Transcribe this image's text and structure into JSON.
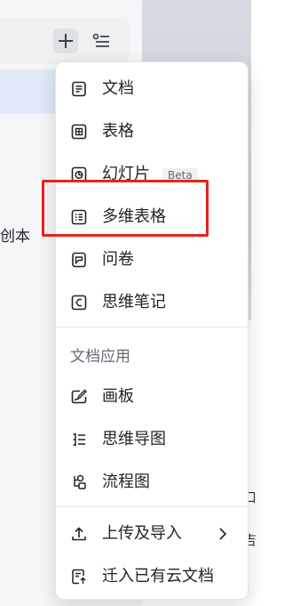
{
  "background": {
    "partial_text": "创本",
    "edge_text_1": "口",
    "edge_text_2": "吉"
  },
  "menu": {
    "items": [
      {
        "label": "文档",
        "icon": "document-icon"
      },
      {
        "label": "表格",
        "icon": "sheet-icon"
      },
      {
        "label": "幻灯片",
        "icon": "slides-icon",
        "badge": "Beta"
      },
      {
        "label": "多维表格",
        "icon": "base-table-icon"
      },
      {
        "label": "问卷",
        "icon": "survey-icon"
      },
      {
        "label": "思维笔记",
        "icon": "mindnote-icon"
      }
    ],
    "apps_title": "文档应用",
    "apps": [
      {
        "label": "画板",
        "icon": "whiteboard-icon"
      },
      {
        "label": "思维导图",
        "icon": "mindmap-icon"
      },
      {
        "label": "流程图",
        "icon": "flowchart-icon"
      }
    ],
    "upload_label": "上传及导入",
    "migrate_label": "迁入已有云文档"
  },
  "highlight_color": "#e5231b"
}
